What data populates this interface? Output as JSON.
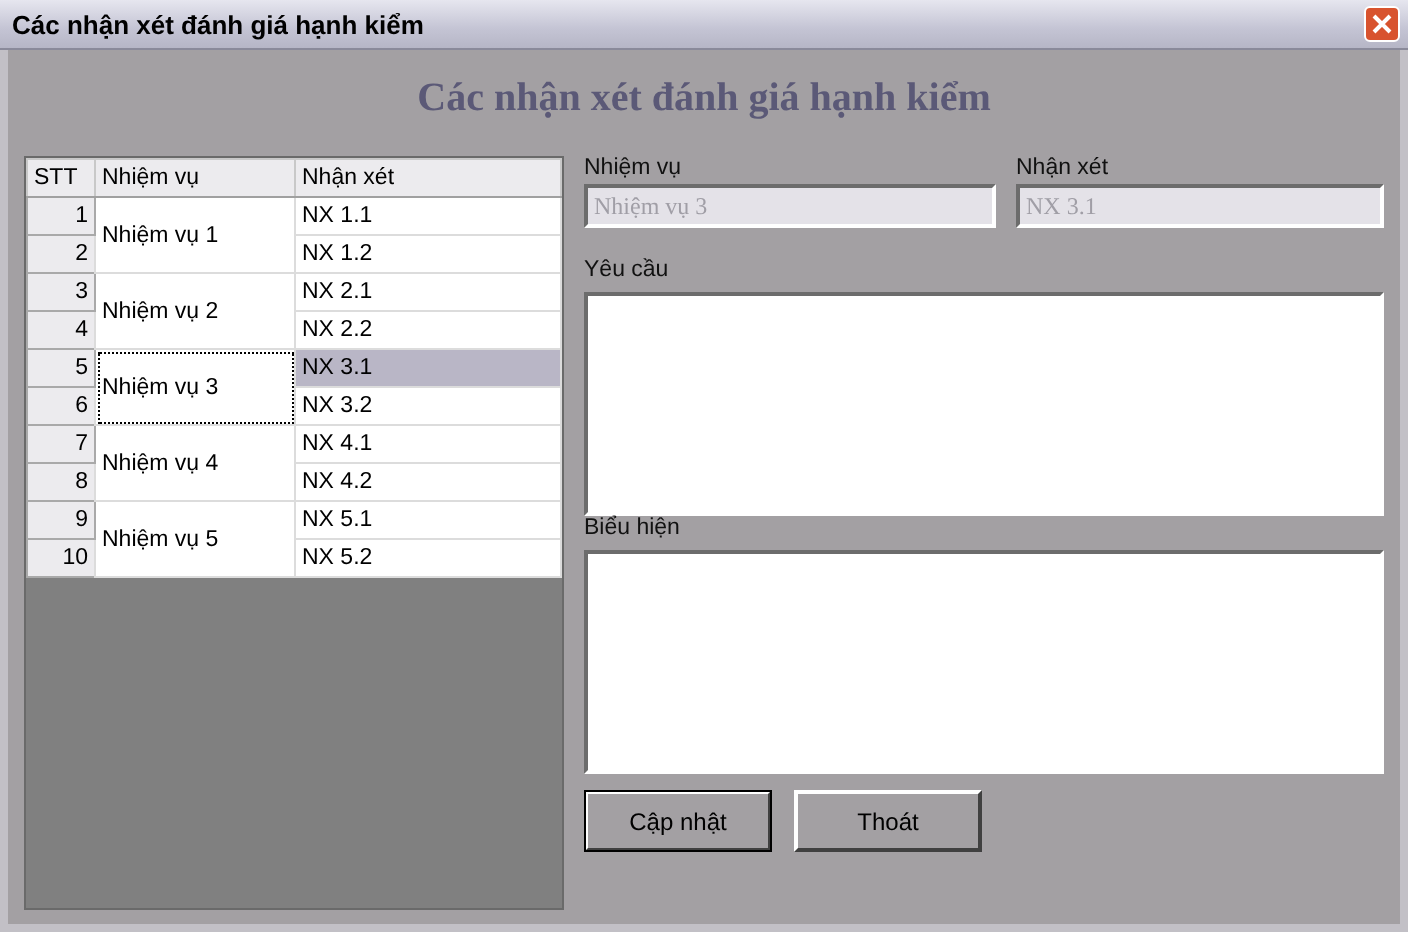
{
  "window": {
    "title": "Các nhận xét đánh giá hạnh kiểm"
  },
  "heading": "Các nhận xét đánh giá hạnh kiểm",
  "table": {
    "columns": [
      "STT",
      "Nhiệm vụ",
      "Nhận xét"
    ],
    "groups": [
      {
        "task": "Nhiệm vụ 1",
        "focused": false,
        "rows": [
          {
            "stt": "1",
            "comment": "NX 1.1",
            "selected": false
          },
          {
            "stt": "2",
            "comment": "NX 1.2",
            "selected": false
          }
        ]
      },
      {
        "task": "Nhiệm vụ 2",
        "focused": false,
        "rows": [
          {
            "stt": "3",
            "comment": "NX 2.1",
            "selected": false
          },
          {
            "stt": "4",
            "comment": "NX 2.2",
            "selected": false
          }
        ]
      },
      {
        "task": "Nhiệm vụ 3",
        "focused": true,
        "rows": [
          {
            "stt": "5",
            "comment": "NX 3.1",
            "selected": true
          },
          {
            "stt": "6",
            "comment": "NX 3.2",
            "selected": false
          }
        ]
      },
      {
        "task": "Nhiệm vụ 4",
        "focused": false,
        "rows": [
          {
            "stt": "7",
            "comment": "NX 4.1",
            "selected": false
          },
          {
            "stt": "8",
            "comment": "NX 4.2",
            "selected": false
          }
        ]
      },
      {
        "task": "Nhiệm vụ 5",
        "focused": false,
        "rows": [
          {
            "stt": "9",
            "comment": "NX 5.1",
            "selected": false
          },
          {
            "stt": "10",
            "comment": "NX 5.2",
            "selected": false
          }
        ]
      }
    ]
  },
  "fields": [
    {
      "label": "Nhiệm vụ",
      "value": "Nhiệm vụ 3",
      "disabled": true
    },
    {
      "label": "Nhận xét",
      "value": "NX 3.1",
      "disabled": true
    }
  ],
  "text_areas": [
    {
      "label": "Yêu cầu"
    },
    {
      "label": "Biểu hiện"
    }
  ],
  "buttons": [
    {
      "label": "Cập nhật",
      "default": true
    },
    {
      "label": "Thoát",
      "default": false
    }
  ]
}
